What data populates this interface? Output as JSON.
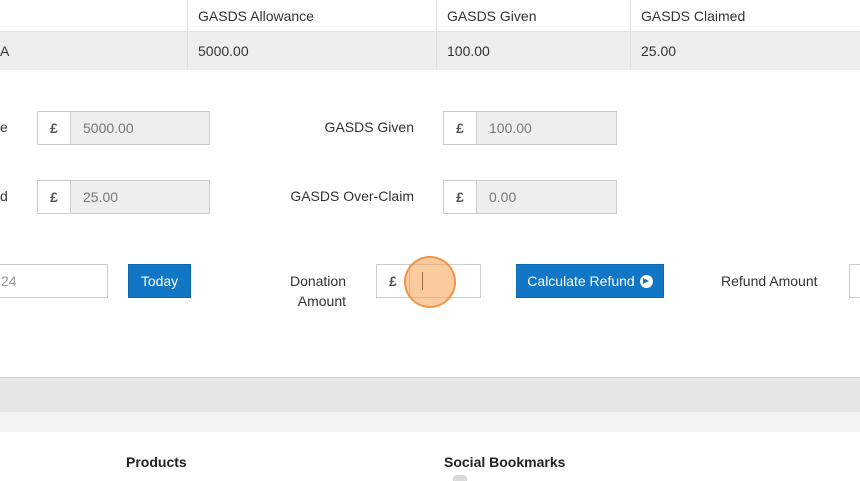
{
  "table": {
    "headers": [
      "GASDS Allowance",
      "GASDS Given",
      "GASDS Claimed"
    ],
    "row": {
      "first": "A",
      "allowance": "5000.00",
      "given": "100.00",
      "claimed": "25.00"
    }
  },
  "summary": {
    "allowance_label_fragment": "e",
    "allowance_currency": "£",
    "allowance_value": "5000.00",
    "given_label": "GASDS Given",
    "given_currency": "£",
    "given_value": "100.00",
    "claimed_label_fragment": "d",
    "claimed_currency": "£",
    "claimed_value": "25.00",
    "overclaim_label": "GASDS Over-Claim",
    "overclaim_currency": "£",
    "overclaim_value": "0.00"
  },
  "refund": {
    "date_value_fragment": "24",
    "today_button": "Today",
    "donation_label_line1": "Donation",
    "donation_label_line2": "Amount",
    "donation_currency": "£",
    "donation_value": "",
    "calculate_button": "Calculate Refund",
    "refund_amount_label": "Refund Amount"
  },
  "footer": {
    "products_heading": "Products",
    "social_heading": "Social Bookmarks"
  },
  "colors": {
    "primary_button": "#1176c5",
    "click_highlight": "#f4a050"
  }
}
